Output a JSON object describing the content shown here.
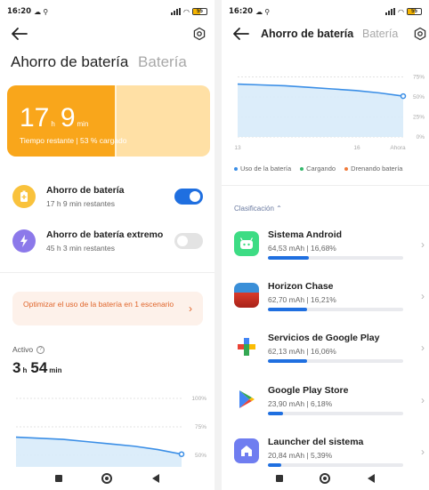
{
  "status": {
    "time": "16:20",
    "battery": "55"
  },
  "left": {
    "tab_active": "Ahorro de batería",
    "tab_inactive": "Batería",
    "card": {
      "hours": "17",
      "hours_unit": "h",
      "minutes": "9",
      "minutes_unit": "min",
      "subtitle": "Tiempo restante | 53 % cargado",
      "charge_percent": 53
    },
    "modes": [
      {
        "title": "Ahorro de batería",
        "subtitle": "17 h 9 min restantes",
        "on": true,
        "color": "#f9c23c"
      },
      {
        "title": "Ahorro de batería extremo",
        "subtitle": "45 h 3 min restantes",
        "on": false,
        "color": "#8c79ea"
      }
    ],
    "optimize": "Optimizar el uso de la batería en 1 escenario",
    "active_label": "Activo",
    "active": {
      "h": "3",
      "h_unit": "h",
      "m": "54",
      "m_unit": "min"
    },
    "chart_ticks": [
      "100%",
      "75%",
      "50%"
    ]
  },
  "right": {
    "title": "Ahorro de batería",
    "tab2": "Batería",
    "chart_ticks": [
      "75%",
      "50%",
      "25%",
      "0%"
    ],
    "x_ticks": [
      "13",
      "16",
      "Ahora"
    ],
    "legend": [
      {
        "label": "Uso de la batería",
        "color": "#3a8ee6"
      },
      {
        "label": "Cargando",
        "color": "#33b86b"
      },
      {
        "label": "Drenando batería",
        "color": "#f07a3a"
      }
    ],
    "sort_label": "Clasificación",
    "apps": [
      {
        "name": "Sistema Android",
        "stat": "64,53 mAh | 16,68%",
        "pct": 16.68
      },
      {
        "name": "Horizon Chase",
        "stat": "62,70 mAh | 16,21%",
        "pct": 16.21
      },
      {
        "name": "Servicios de Google Play",
        "stat": "62,13 mAh | 16,06%",
        "pct": 16.06
      },
      {
        "name": "Google Play Store",
        "stat": "23,90 mAh | 6,18%",
        "pct": 6.18
      },
      {
        "name": "Launcher del sistema",
        "stat": "20,84 mAh | 5,39%",
        "pct": 5.39
      }
    ]
  },
  "chart_data": {
    "type": "area",
    "title": "",
    "xlabel": "",
    "ylabel": "",
    "x": [
      "13",
      "14",
      "15",
      "16",
      "17",
      "Ahora"
    ],
    "series": [
      {
        "values": [
          66,
          65,
          64,
          62,
          60,
          58,
          55,
          51
        ]
      }
    ],
    "ylim": [
      0,
      100
    ]
  }
}
